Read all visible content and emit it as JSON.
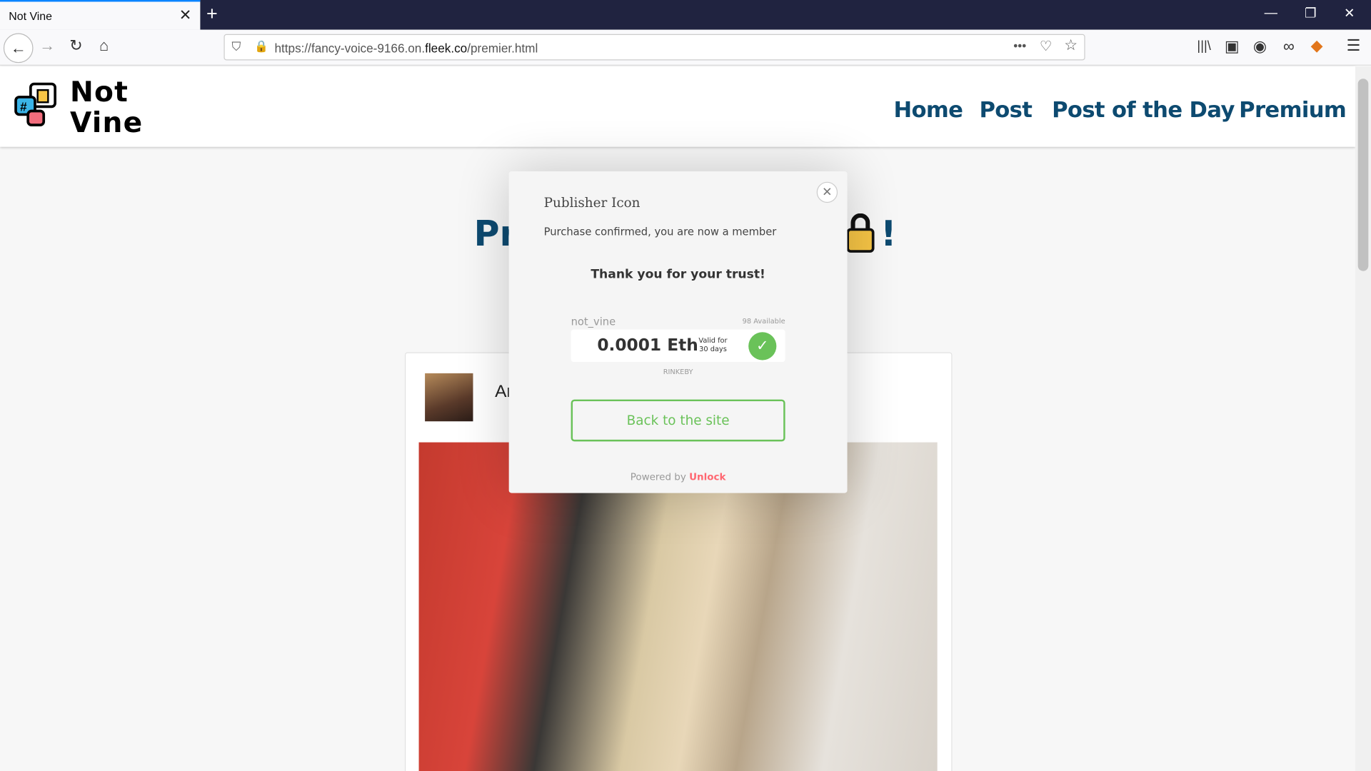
{
  "browser": {
    "tab_title": "Not Vine",
    "url_prefix": "https://fancy-voice-9166.on.",
    "url_domain": "fleek.co",
    "url_path": "/premier.html"
  },
  "site": {
    "logo_line1": "Not",
    "logo_line2": "Vine",
    "nav": [
      "Home",
      "Post",
      "Post of the Day",
      "Premium"
    ],
    "heading_left": "Pr",
    "heading_right": "!",
    "author_partial": "Ar"
  },
  "modal": {
    "title": "Publisher Icon",
    "subtitle": "Purchase confirmed, you are now a member",
    "thanks": "Thank you for your trust!",
    "lock_name": "not_vine",
    "available": "98 Available",
    "price": "0.0001 Eth",
    "valid_line1": "Valid for",
    "valid_line2": "30 days",
    "network": "RINKEBY",
    "back_button": "Back to the site",
    "powered_by": "Powered by",
    "brand": "Unlock"
  },
  "colors": {
    "nav": "#0d4a70",
    "success": "#6ac259",
    "unlock": "#ff6771",
    "tabbar": "#202340"
  }
}
